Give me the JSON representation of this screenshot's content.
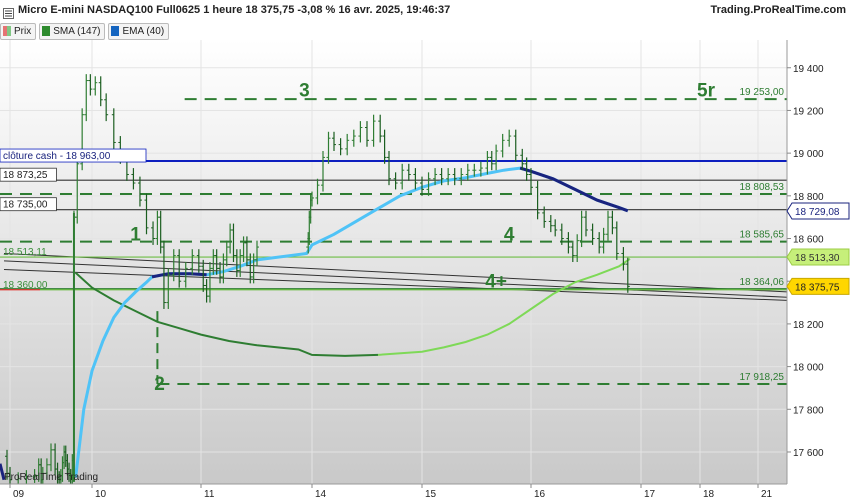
{
  "header": {
    "title": "Micro E-mini NASDAQ100 Full0625 1 heure 18 375,75 -3,08 % 16 avr. 2025, 19:46:37",
    "site": "Trading.ProRealTime.com",
    "footer": "ProRealTime Trading"
  },
  "legend": [
    {
      "label": "Prix",
      "color": "#4caf50"
    },
    {
      "label": "SMA (147)",
      "color": "#2e8b2e"
    },
    {
      "label": "EMA (40)",
      "color": "#1565c0"
    }
  ],
  "chart_data": {
    "type": "line",
    "instrument": "Micro E-mini NASDAQ100 Full0625",
    "timeframe": "1 heure",
    "last_price": "18 375,75",
    "change": "-3,08 %",
    "timestamp": "16 avr. 2025, 19:46:37",
    "ylim": [
      17450,
      19530
    ],
    "y_ticks": [
      {
        "value": 17600,
        "label": "17 600"
      },
      {
        "value": 17800,
        "label": "17 800"
      },
      {
        "value": 18000,
        "label": "18 000"
      },
      {
        "value": 18200,
        "label": "18 200"
      },
      {
        "value": 18400,
        "label": "18 400"
      },
      {
        "value": 18600,
        "label": "18 600"
      },
      {
        "value": 18800,
        "label": "18 800"
      },
      {
        "value": 19000,
        "label": "19 000"
      },
      {
        "value": 19200,
        "label": "19 200"
      },
      {
        "value": 19400,
        "label": "19 400"
      }
    ],
    "x_ticks": [
      {
        "day": 9,
        "label": "09"
      },
      {
        "day": 10,
        "label": "10"
      },
      {
        "day": 11,
        "label": "11"
      },
      {
        "day": 14,
        "label": "14"
      },
      {
        "day": 15,
        "label": "15"
      },
      {
        "day": 16,
        "label": "16"
      },
      {
        "day": 17,
        "label": "17"
      },
      {
        "day": 18,
        "label": "18"
      },
      {
        "day": 21,
        "label": "21"
      }
    ],
    "level_lines": [
      {
        "value": 19253.0,
        "label": "19 253,00",
        "style": "dashed",
        "color": "#2e7d32"
      },
      {
        "value": 18808.53,
        "label": "18 808,53",
        "style": "dashed",
        "color": "#2e7d32"
      },
      {
        "value": 18585.65,
        "label": "18 585,65",
        "style": "dashed",
        "color": "#2e7d32"
      },
      {
        "value": 18364.06,
        "label": "18 364,06",
        "style": "solid",
        "color": "#2e7d32"
      },
      {
        "value": 17918.25,
        "label": "17 918,25",
        "style": "dashed",
        "color": "#2e7d32"
      }
    ],
    "left_labels": [
      {
        "value": 18963.0,
        "label": "clôture cash -  18 963,00",
        "color": "#1a237e",
        "line_color": "#0d1fbf"
      },
      {
        "value": 18873.25,
        "label": "18 873,25",
        "color": "#222",
        "line_color": "#333"
      },
      {
        "value": 18735.0,
        "label": "18 735,00",
        "color": "#222",
        "line_color": "#333"
      },
      {
        "value": 18513.11,
        "label": "18 513,11",
        "color": "#3b8f3b",
        "line_color": "#6dbd45"
      },
      {
        "value": 18360.0,
        "label": "18 360,00",
        "color": "#3b8f3b",
        "line_color": "#e53935"
      }
    ],
    "right_badges": [
      {
        "value": 18729.08,
        "label": "18 729,08",
        "bg": "#ffffff",
        "fg": "#1a237e",
        "border": "#1a237e"
      },
      {
        "value": 18513.3,
        "label": "18 513,30",
        "bg": "#c6ef7a",
        "fg": "#333",
        "border": "#9ccc45"
      },
      {
        "value": 18375.75,
        "label": "18 375,75",
        "bg": "#ffd600",
        "fg": "#222",
        "border": "#c8a800"
      }
    ],
    "wave_labels": [
      {
        "label": "1",
        "t": 10.4,
        "y": 18590
      },
      {
        "label": "2",
        "t": 10.62,
        "y": 17890
      },
      {
        "label": "3",
        "t": 13.72,
        "y": 19265
      },
      {
        "label": "4",
        "t": 15.8,
        "y": 18590
      },
      {
        "label": "4+",
        "t": 15.68,
        "y": 18370
      },
      {
        "label": "5r",
        "t": 18.3,
        "y": 19265
      }
    ],
    "price_series": [
      [
        8.7,
        17580
      ],
      [
        8.85,
        17500
      ],
      [
        9.0,
        17470
      ],
      [
        9.1,
        17475
      ],
      [
        9.2,
        17485
      ],
      [
        9.3,
        17490
      ],
      [
        9.35,
        17540
      ],
      [
        9.38,
        17470
      ],
      [
        9.4,
        17500
      ],
      [
        9.45,
        17540
      ],
      [
        9.5,
        17610
      ],
      [
        9.55,
        17520
      ],
      [
        9.58,
        17480
      ],
      [
        9.6,
        17470
      ],
      [
        9.62,
        17490
      ],
      [
        9.64,
        17550
      ],
      [
        9.66,
        17600
      ],
      [
        9.68,
        17560
      ],
      [
        9.7,
        17520
      ],
      [
        9.72,
        17490
      ],
      [
        9.74,
        17480
      ],
      [
        9.76,
        17560
      ],
      [
        9.78,
        18700
      ],
      [
        9.82,
        18950
      ],
      [
        9.88,
        19180
      ],
      [
        9.93,
        19340
      ],
      [
        9.98,
        19300
      ],
      [
        10.03,
        19330
      ],
      [
        10.08,
        19250
      ],
      [
        10.13,
        19180
      ],
      [
        10.2,
        19050
      ],
      [
        10.26,
        18980
      ],
      [
        10.32,
        18900
      ],
      [
        10.38,
        18860
      ],
      [
        10.44,
        18780
      ],
      [
        10.5,
        18650
      ],
      [
        10.56,
        18600
      ],
      [
        10.6,
        18700
      ],
      [
        10.63,
        18560
      ],
      [
        10.66,
        18300
      ],
      [
        10.7,
        18430
      ],
      [
        10.75,
        18520
      ],
      [
        10.8,
        18400
      ],
      [
        10.86,
        18460
      ],
      [
        10.92,
        18520
      ],
      [
        10.98,
        18470
      ],
      [
        11.04,
        18380
      ],
      [
        11.1,
        18330
      ],
      [
        11.16,
        18460
      ],
      [
        11.22,
        18520
      ],
      [
        11.28,
        18460
      ],
      [
        11.34,
        18420
      ],
      [
        11.4,
        18500
      ],
      [
        11.46,
        18560
      ],
      [
        11.52,
        18640
      ],
      [
        11.58,
        18520
      ],
      [
        11.64,
        18450
      ],
      [
        11.7,
        18520
      ],
      [
        11.76,
        18580
      ],
      [
        11.82,
        18500
      ],
      [
        11.88,
        18420
      ],
      [
        11.94,
        18500
      ],
      [
        12.0,
        18560
      ],
      [
        13.86,
        18600
      ],
      [
        13.9,
        18700
      ],
      [
        13.95,
        18780
      ],
      [
        14.0,
        18790
      ],
      [
        14.05,
        18850
      ],
      [
        14.1,
        18980
      ],
      [
        14.15,
        19070
      ],
      [
        14.2,
        19040
      ],
      [
        14.26,
        19020
      ],
      [
        14.32,
        19060
      ],
      [
        14.38,
        19080
      ],
      [
        14.44,
        19120
      ],
      [
        14.5,
        19060
      ],
      [
        14.56,
        19150
      ],
      [
        14.62,
        19080
      ],
      [
        14.66,
        18980
      ],
      [
        14.7,
        18880
      ],
      [
        14.76,
        18860
      ],
      [
        14.82,
        18920
      ],
      [
        14.88,
        18900
      ],
      [
        14.94,
        18860
      ],
      [
        15.0,
        18830
      ],
      [
        15.06,
        18880
      ],
      [
        15.12,
        18900
      ],
      [
        15.18,
        18880
      ],
      [
        15.24,
        18900
      ],
      [
        15.3,
        18880
      ],
      [
        15.36,
        18900
      ],
      [
        15.42,
        18920
      ],
      [
        15.48,
        18920
      ],
      [
        15.54,
        18930
      ],
      [
        15.6,
        18980
      ],
      [
        15.64,
        18950
      ],
      [
        15.68,
        19010
      ],
      [
        15.74,
        19060
      ],
      [
        15.8,
        19080
      ],
      [
        15.86,
        18990
      ],
      [
        15.92,
        18950
      ],
      [
        15.96,
        18900
      ],
      [
        16.0,
        18840
      ],
      [
        16.06,
        18720
      ],
      [
        16.12,
        18680
      ],
      [
        16.18,
        18660
      ],
      [
        16.22,
        18640
      ],
      [
        16.28,
        18600
      ],
      [
        16.34,
        18560
      ],
      [
        16.38,
        18520
      ],
      [
        16.42,
        18590
      ],
      [
        16.46,
        18700
      ],
      [
        16.5,
        18640
      ],
      [
        16.56,
        18600
      ],
      [
        16.62,
        18560
      ],
      [
        16.66,
        18620
      ],
      [
        16.7,
        18700
      ],
      [
        16.74,
        18650
      ],
      [
        16.78,
        18530
      ],
      [
        16.84,
        18480
      ],
      [
        16.88,
        18375.75
      ]
    ],
    "sma_series": [
      [
        9.8,
        18440
      ],
      [
        10.0,
        18370
      ],
      [
        10.2,
        18310
      ],
      [
        10.4,
        18260
      ],
      [
        10.6,
        18210
      ],
      [
        10.8,
        18180
      ],
      [
        11.0,
        18150
      ],
      [
        11.5,
        18120
      ],
      [
        12.0,
        18100
      ],
      [
        13.5,
        18080
      ],
      [
        14.0,
        18055
      ],
      [
        14.3,
        18050
      ],
      [
        14.6,
        18055
      ],
      [
        15.0,
        18070
      ],
      [
        15.2,
        18090
      ],
      [
        15.4,
        18115
      ],
      [
        15.6,
        18150
      ],
      [
        15.8,
        18200
      ],
      [
        16.0,
        18270
      ],
      [
        16.2,
        18340
      ],
      [
        16.4,
        18395
      ],
      [
        16.6,
        18430
      ],
      [
        16.8,
        18470
      ],
      [
        16.9,
        18505
      ]
    ],
    "ema_series": [
      [
        9.8,
        17480
      ],
      [
        9.9,
        17800
      ],
      [
        10.0,
        17980
      ],
      [
        10.1,
        18120
      ],
      [
        10.2,
        18230
      ],
      [
        10.3,
        18300
      ],
      [
        10.4,
        18350
      ],
      [
        10.5,
        18395
      ],
      [
        10.55,
        18420
      ],
      [
        10.7,
        18435
      ],
      [
        10.9,
        18435
      ],
      [
        11.1,
        18430
      ],
      [
        11.4,
        18445
      ],
      [
        11.7,
        18470
      ],
      [
        12.0,
        18500
      ],
      [
        13.8,
        18530
      ],
      [
        14.0,
        18570
      ],
      [
        14.2,
        18620
      ],
      [
        14.4,
        18680
      ],
      [
        14.6,
        18740
      ],
      [
        14.8,
        18800
      ],
      [
        15.0,
        18840
      ],
      [
        15.2,
        18870
      ],
      [
        15.4,
        18885
      ],
      [
        15.6,
        18905
      ],
      [
        15.75,
        18920
      ],
      [
        15.9,
        18930
      ],
      [
        16.0,
        18915
      ],
      [
        16.2,
        18880
      ],
      [
        16.4,
        18830
      ],
      [
        16.6,
        18780
      ],
      [
        16.8,
        18745
      ],
      [
        16.88,
        18730
      ]
    ],
    "trend_lines": [
      {
        "from": [
          8.7,
          18530
        ],
        "to": [
          21.5,
          18350
        ],
        "color": "#333"
      },
      {
        "from": [
          8.7,
          18495
        ],
        "to": [
          21.5,
          18325
        ],
        "color": "#333"
      },
      {
        "from": [
          8.7,
          18455
        ],
        "to": [
          21.5,
          18310
        ],
        "color": "#333"
      }
    ],
    "grid": true
  }
}
